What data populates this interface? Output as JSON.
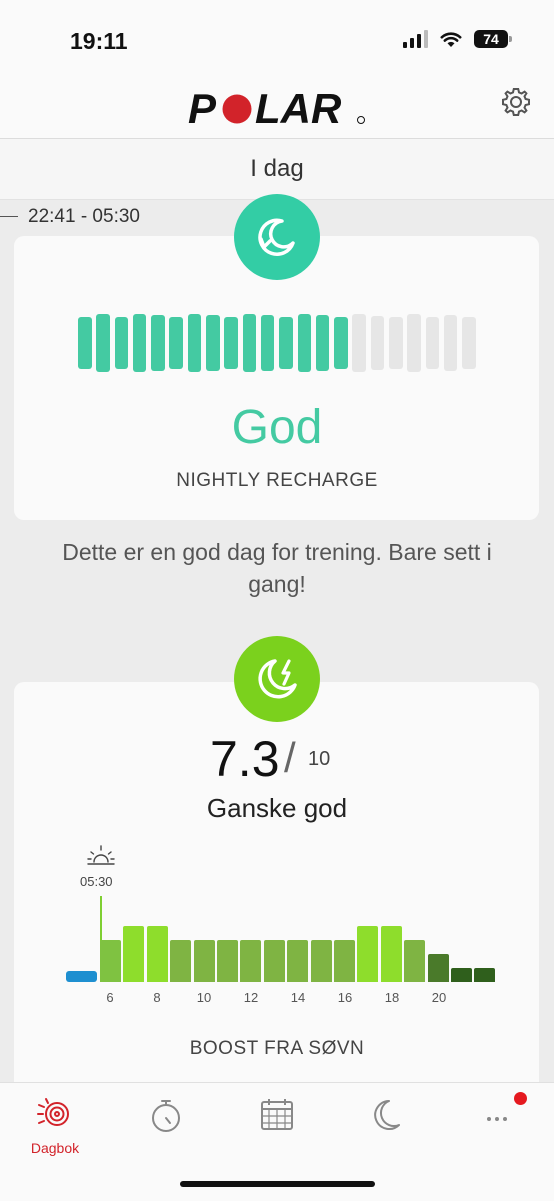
{
  "status_bar": {
    "time": "19:11",
    "battery": "74"
  },
  "header": {
    "logo_text": "POLAR",
    "logo_color": "#d2232a",
    "settings_icon": "gear-icon"
  },
  "day": {
    "title": "I dag"
  },
  "sleep_range": "22:41 - 05:30",
  "recharge": {
    "icon": "nightly-recharge-icon",
    "status": "God",
    "label": "NIGHTLY RECHARGE",
    "level_filled": 15,
    "level_total": 22,
    "color": "#44caa2"
  },
  "message": "Dette er en god dag for trening. Bare sett i gang!",
  "sleep_score": {
    "icon": "sleep-boost-icon",
    "score": "7.3",
    "slash": "/",
    "max": "10",
    "label": "Ganske god",
    "wake_time": "05:30",
    "boost_label": "BOOST FRA SØVN"
  },
  "chart_data": {
    "type": "bar",
    "x_ticks": [
      "6",
      "8",
      "10",
      "12",
      "14",
      "16",
      "18",
      "20"
    ],
    "values": [
      1,
      3,
      4,
      4,
      3,
      3,
      3,
      3,
      3,
      3,
      3,
      3,
      4,
      4,
      3,
      2,
      1,
      1
    ],
    "ylim": [
      0,
      4
    ],
    "colors": [
      "#1e8fd0",
      "#7fc241",
      "#8edd2c",
      "#8edd2c",
      "#7fb443",
      "#7fb443",
      "#7fb443",
      "#7fb443",
      "#7fb443",
      "#7fb443",
      "#7fb443",
      "#7fb443",
      "#8edd2c",
      "#8edd2c",
      "#7fb443",
      "#4a7a2a",
      "#2f5f1c",
      "#2f5f1c"
    ]
  },
  "tabs": [
    {
      "name": "diary",
      "label": "Dagbok",
      "icon": "diary-icon",
      "active": true
    },
    {
      "name": "training",
      "label": "",
      "icon": "stopwatch-icon"
    },
    {
      "name": "calendar",
      "label": "",
      "icon": "calendar-icon"
    },
    {
      "name": "sleep",
      "label": "",
      "icon": "moon-icon"
    },
    {
      "name": "more",
      "label": "",
      "icon": "more-icon",
      "notification": true
    }
  ]
}
